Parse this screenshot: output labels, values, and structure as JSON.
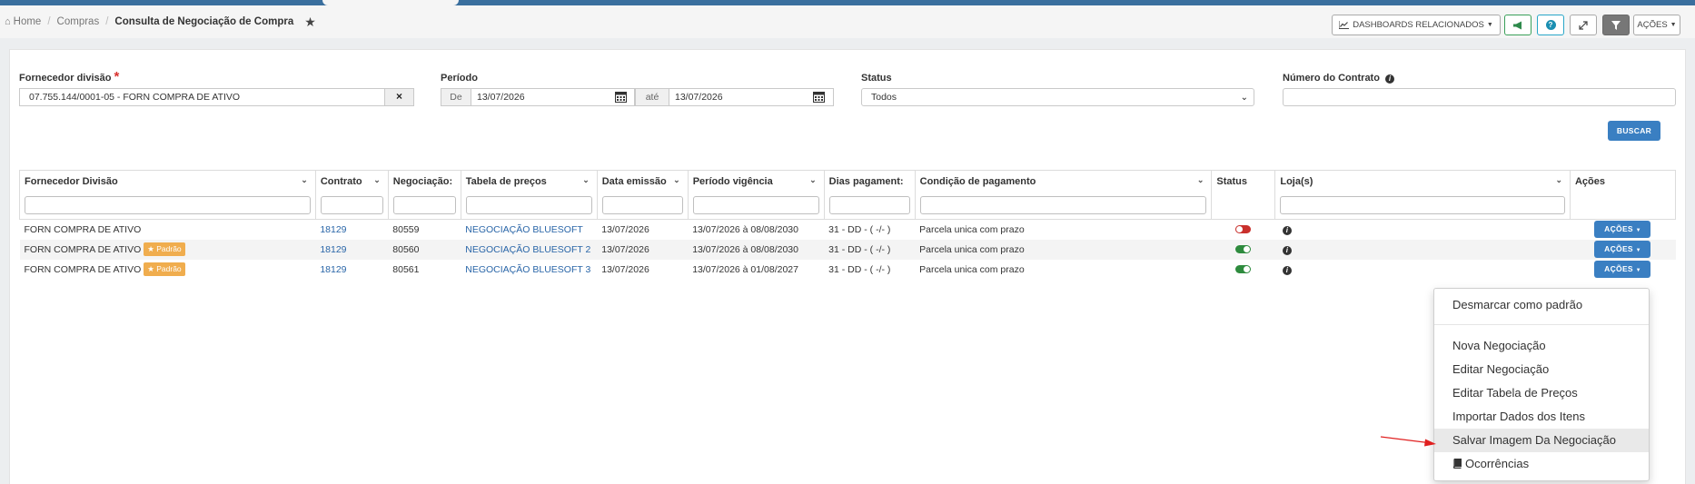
{
  "breadcrumb": {
    "home": "Home",
    "section": "Compras",
    "current": "Consulta de Negociação de Compra"
  },
  "toolbar": {
    "dashboards_label": "DASHBOARDS RELACIONADOS",
    "actions_label": "AÇÕES"
  },
  "form": {
    "supplier_label": "Fornecedor divisão",
    "supplier_value": "07.755.144/0001-05 - FORN COMPRA DE ATIVO",
    "period_label": "Período",
    "from_label": "De",
    "from_value": "13/07/2026",
    "to_label": "até",
    "to_value": "13/07/2026",
    "status_label": "Status",
    "status_value": "Todos",
    "contract_label": "Número do Contrato",
    "search_button": "BUSCAR"
  },
  "grid": {
    "columns": [
      "Fornecedor Divisão",
      "Contrato",
      "Negociação:",
      "Tabela de preços",
      "Data emissão",
      "Período vigência",
      "Dias pagament:",
      "Condição de pagamento",
      "Status",
      "Loja(s)",
      "Ações"
    ],
    "badge_label": "Padrão",
    "action_button": "AÇÕES",
    "rows": [
      {
        "supplier": "FORN COMPRA DE ATIVO",
        "default": false,
        "contract": "18129",
        "negotiation": "80559",
        "price_table": "NEGOCIAÇÃO BLUESOFT",
        "issue_date": "13/07/2026",
        "validity": "13/07/2026 à 08/08/2030",
        "payment_days": "31 - DD - ( -/- )",
        "payment_condition": "Parcela unica com prazo",
        "status_on": false
      },
      {
        "supplier": "FORN COMPRA DE ATIVO",
        "default": true,
        "contract": "18129",
        "negotiation": "80560",
        "price_table": "NEGOCIAÇÃO BLUESOFT 2",
        "issue_date": "13/07/2026",
        "validity": "13/07/2026 à 08/08/2030",
        "payment_days": "31 - DD - ( -/- )",
        "payment_condition": "Parcela unica com prazo",
        "status_on": true
      },
      {
        "supplier": "FORN COMPRA DE ATIVO",
        "default": true,
        "contract": "18129",
        "negotiation": "80561",
        "price_table": "NEGOCIAÇÃO BLUESOFT 3",
        "issue_date": "13/07/2026",
        "validity": "13/07/2026 à 01/08/2027",
        "payment_days": "31 - DD - ( -/- )",
        "payment_condition": "Parcela unica com prazo",
        "status_on": true
      }
    ]
  },
  "menu": {
    "items": [
      "Desmarcar como padrão",
      "Nova Negociação",
      "Editar Negociação",
      "Editar Tabela de Preços",
      "Importar Dados dos Itens",
      "Salvar Imagem Da Negociação",
      "Ocorrências"
    ],
    "highlighted_index": 5
  },
  "colors": {
    "primary": "#3a7fc2",
    "badge": "#f0ad4e",
    "toggle_on": "#2e8b3e",
    "toggle_off": "#c9302c",
    "arrow": "#e02020"
  }
}
